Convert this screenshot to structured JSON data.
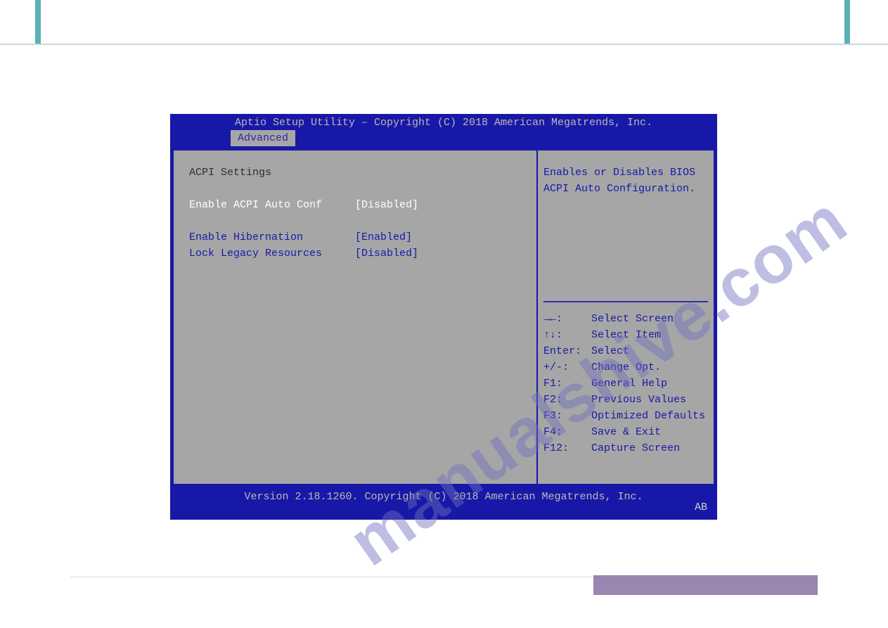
{
  "watermark": "manualshive.com",
  "bios": {
    "title": "Aptio Setup Utility – Copyright (C) 2018 American Megatrends, Inc.",
    "tab": "Advanced",
    "section": "ACPI Settings",
    "settings": [
      {
        "label": "Enable ACPI Auto Conf",
        "value": "[Disabled]",
        "selected": true
      },
      {
        "label": "Enable Hibernation",
        "value": "[Enabled]",
        "selected": false
      },
      {
        "label": "Lock Legacy Resources",
        "value": "[Disabled]",
        "selected": false
      }
    ],
    "description": "Enables or Disables BIOS ACPI Auto Configuration.",
    "help": [
      {
        "key": "→←:",
        "text": "Select Screen"
      },
      {
        "key": "↑↓:",
        "text": "Select Item"
      },
      {
        "key": "Enter:",
        "text": "Select"
      },
      {
        "key": "+/-:",
        "text": "Change Opt."
      },
      {
        "key": "F1:",
        "text": "General Help"
      },
      {
        "key": "F2:",
        "text": "Previous Values"
      },
      {
        "key": "F3:",
        "text": "Optimized Defaults"
      },
      {
        "key": "F4:",
        "text": "Save & Exit"
      },
      {
        "key": "F12:",
        "text": "Capture Screen"
      }
    ],
    "footer": "Version 2.18.1260. Copyright (C) 2018 American Megatrends, Inc.",
    "corner": "AB"
  }
}
